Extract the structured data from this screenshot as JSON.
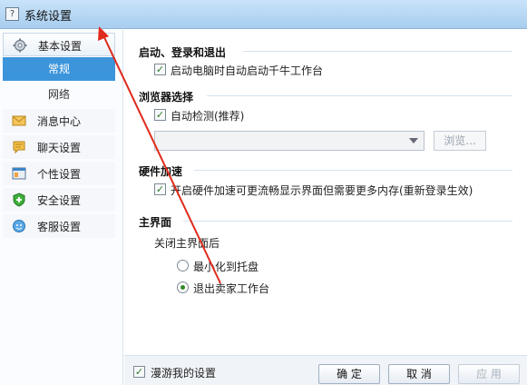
{
  "window": {
    "title": "系统设置",
    "app_icon_glyph": "?"
  },
  "sidebar": {
    "items": [
      {
        "label": "基本设置",
        "icon": "gear-icon"
      },
      {
        "label": "常规"
      },
      {
        "label": "网络"
      },
      {
        "label": "消息中心",
        "icon": "envelope-icon"
      },
      {
        "label": "聊天设置",
        "icon": "chat-bubble-icon"
      },
      {
        "label": "个性设置",
        "icon": "window-icon"
      },
      {
        "label": "安全设置",
        "icon": "shield-plus-icon"
      },
      {
        "label": "客服设置",
        "icon": "service-icon"
      }
    ]
  },
  "sections": {
    "startup": {
      "title": "启动、登录和退出",
      "autostart_label": "启动电脑时自动启动千牛工作台",
      "autostart_checked": true
    },
    "browser": {
      "title": "浏览器选择",
      "autodetect_label": "自动检测(推荐)",
      "autodetect_checked": true,
      "select_value": "",
      "browse_label": "浏览..."
    },
    "hardware": {
      "title": "硬件加速",
      "accel_label": "开启硬件加速可更流畅显示界面但需要更多内存(重新登录生效)",
      "accel_checked": true
    },
    "main_ui": {
      "title": "主界面",
      "close_label": "关闭主界面后",
      "options": [
        {
          "label": "最小化到托盘",
          "selected": false
        },
        {
          "label": "退出卖家工作台",
          "selected": true
        }
      ]
    }
  },
  "footer": {
    "roam_label": "漫游我的设置",
    "roam_checked": true,
    "ok_label": "确 定",
    "cancel_label": "取 消",
    "apply_label": "应 用"
  },
  "colors": {
    "accent": "#3c95db",
    "annotation_arrow": "#e02a1c",
    "check": "#2b7a21"
  }
}
